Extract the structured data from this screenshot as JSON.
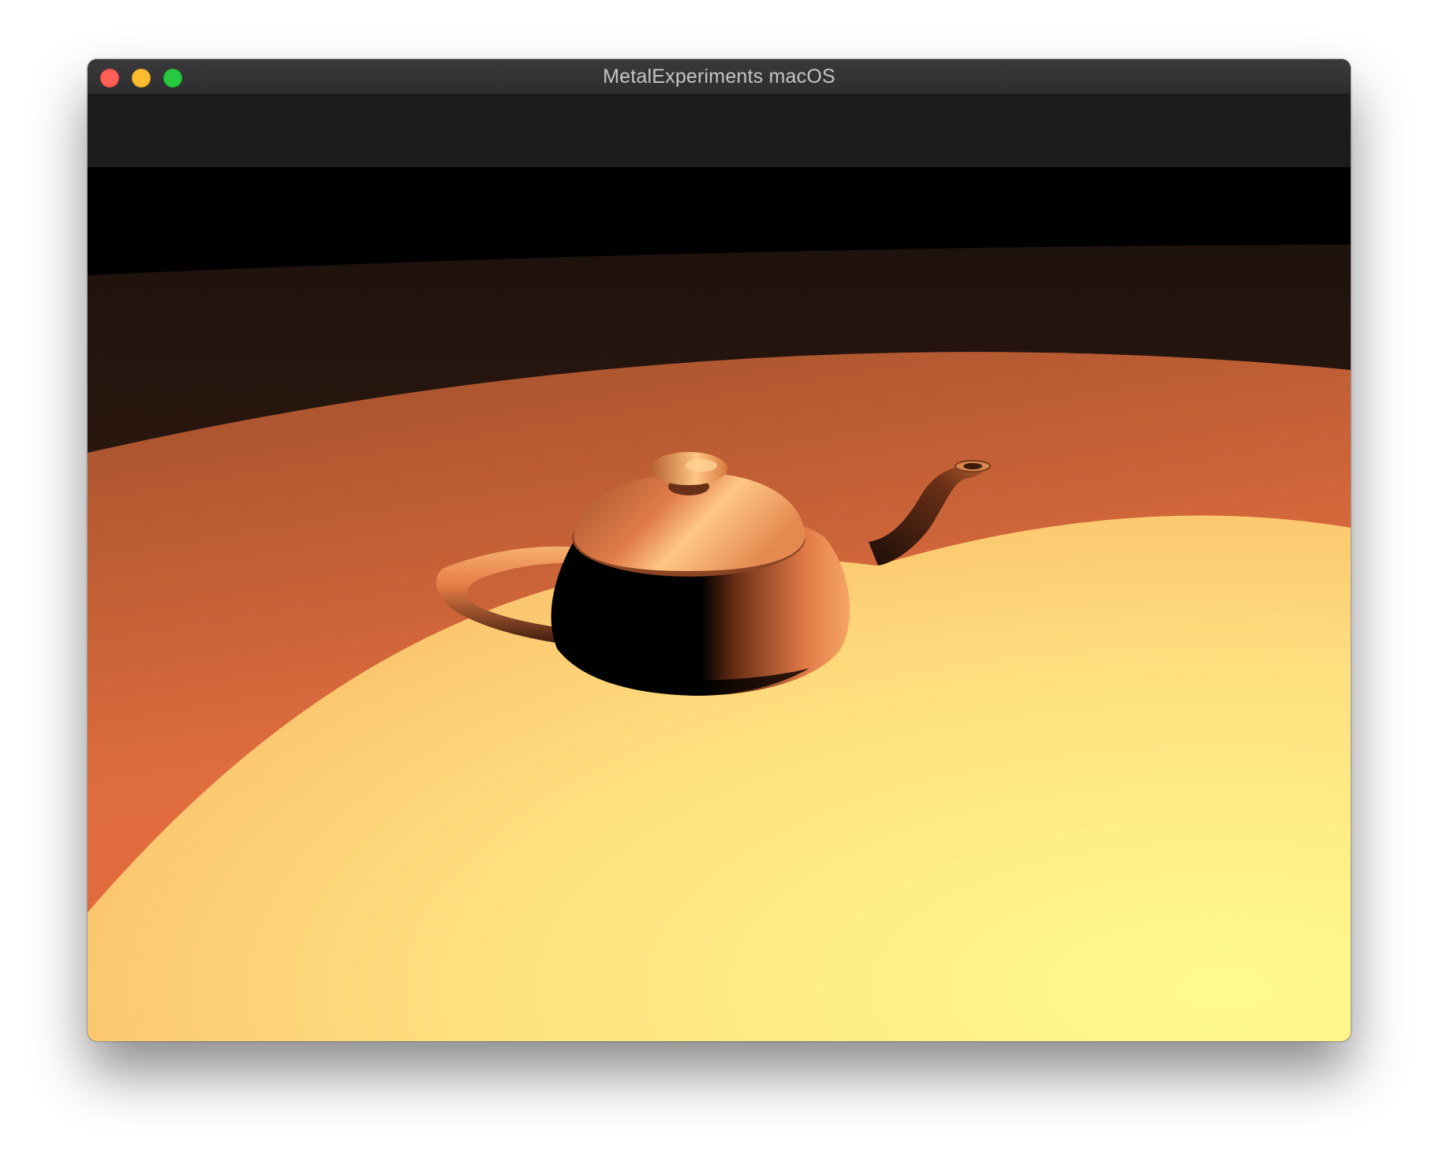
{
  "window": {
    "title": "MetalExperiments macOS",
    "buttons": {
      "close": "close-button",
      "minimize": "minimize-button",
      "zoom": "zoom-button"
    },
    "colors": {
      "close": "#fe5f57",
      "minimize": "#febc2e",
      "zoom": "#28c840"
    }
  },
  "scene": {
    "object": "teapot",
    "colors": {
      "sky": "#000000",
      "far_floor": "#2b1a12",
      "mid_floor": "#d9703e",
      "lit_floor": "#fff58a",
      "teapot_lit": "#f4a062",
      "teapot_shadow": "#000000"
    }
  }
}
